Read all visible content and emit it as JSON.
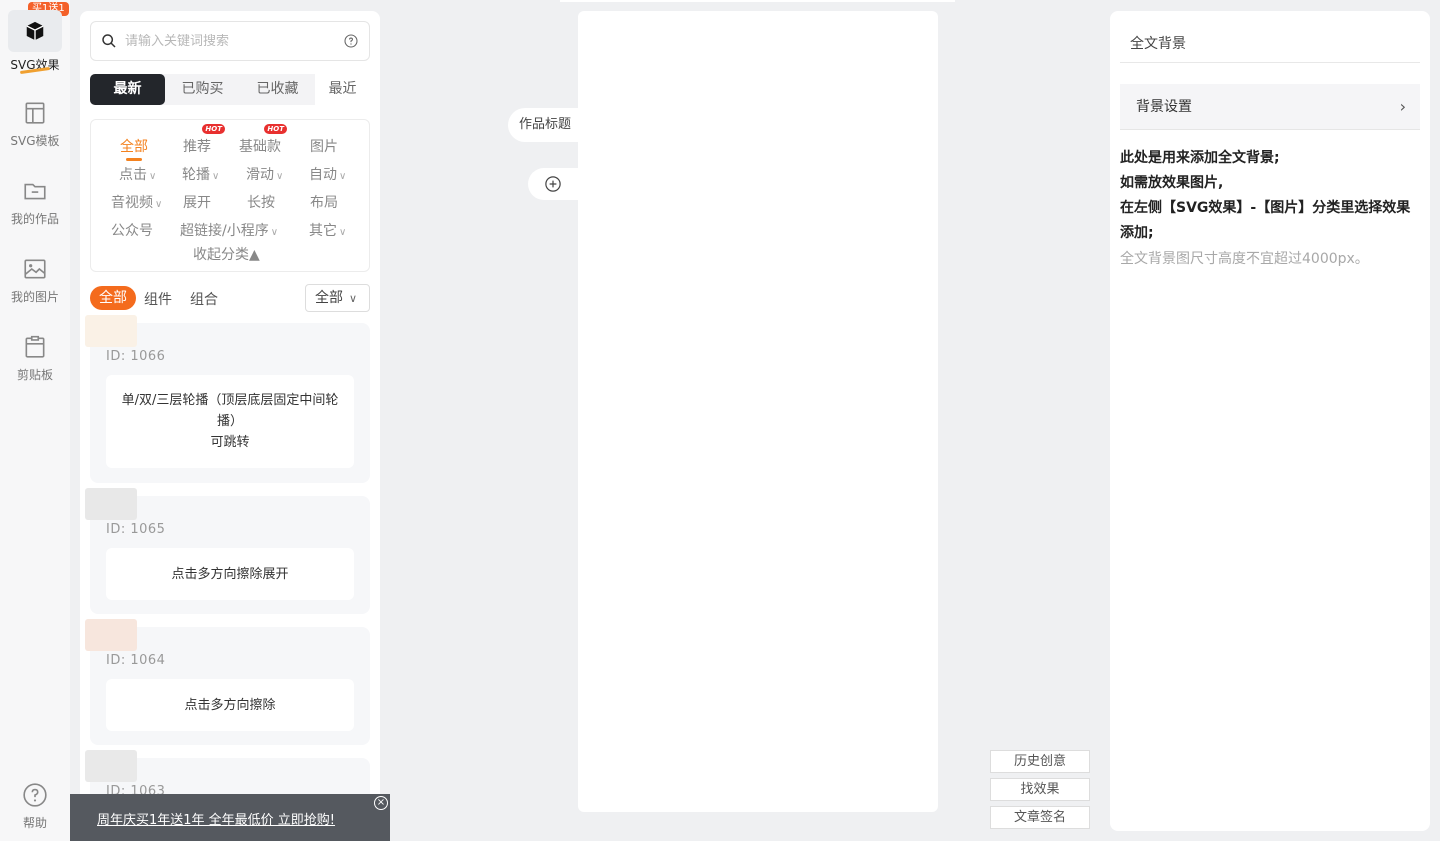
{
  "rail": {
    "promo_badge": "买1送1",
    "items": [
      {
        "label": "SVG效果",
        "icon": "cube-icon"
      },
      {
        "label": "SVG模板",
        "icon": "layout-icon"
      },
      {
        "label": "我的作品",
        "icon": "folder-icon"
      },
      {
        "label": "我的图片",
        "icon": "image-icon"
      },
      {
        "label": "剪贴板",
        "icon": "clipboard-icon"
      }
    ],
    "help": {
      "label": "帮助",
      "icon": "help-circle-icon"
    }
  },
  "library": {
    "search_placeholder": "请输入关键词搜索",
    "tabs": [
      "最新",
      "已购买",
      "已收藏",
      "最近"
    ],
    "categories": {
      "all": "全部",
      "recommend": "推荐",
      "basic": "基础款",
      "image": "图片",
      "click": "点击",
      "carousel": "轮播",
      "slide": "滑动",
      "auto": "自动",
      "av": "音视频",
      "expand": "展开",
      "longpress": "长按",
      "layout": "布局",
      "official": "公众号",
      "links": "超链接/小程序",
      "other": "其它",
      "hot": "HOT",
      "collapse": "收起分类▲"
    },
    "filters": {
      "all": "全部",
      "component": "组件",
      "combo": "组合",
      "dropdown": "全部"
    },
    "cards": [
      {
        "id": "ID: 1066",
        "desc1": "单/双/三层轮播（顶层底层固定中间轮播）",
        "desc2": "可跳转"
      },
      {
        "id": "ID: 1065",
        "desc1": "点击多方向擦除展开",
        "desc2": ""
      },
      {
        "id": "ID: 1064",
        "desc1": "点击多方向擦除",
        "desc2": ""
      },
      {
        "id": "ID: 1063",
        "desc1": "",
        "desc2": ""
      }
    ]
  },
  "banner": {
    "text": "周年庆买1年送1年 全年最低价 立即抢购!"
  },
  "canvas": {
    "title_tab": "作品标题"
  },
  "side_buttons": [
    "历史创意",
    "找效果",
    "文章签名"
  ],
  "right_panel": {
    "title": "全文背景",
    "row_label": "背景设置",
    "lines": [
      "此处是用来添加全文背景;",
      "如需放效果图片,",
      "在左侧【SVG效果】-【图片】分类里选择效果",
      "添加;"
    ],
    "note": "全文背景图尺寸高度不宜超过4000px。"
  }
}
